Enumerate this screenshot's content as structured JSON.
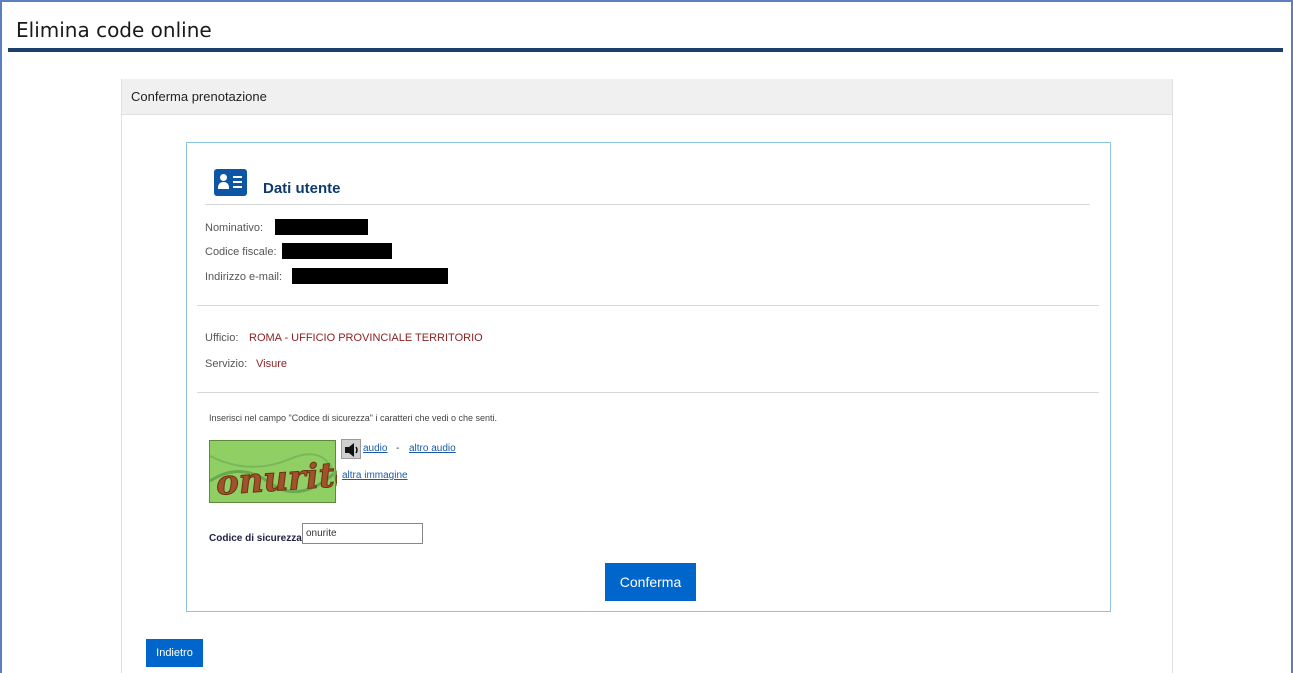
{
  "header": {
    "title": "Elimina code online"
  },
  "panel": {
    "title": "Conferma prenotazione"
  },
  "user": {
    "heading": "Dati utente",
    "icon": "user-card-icon",
    "fields": [
      {
        "label": "Nominativo:"
      },
      {
        "label": "Codice fiscale:"
      },
      {
        "label": "Indirizzo e-mail:"
      }
    ]
  },
  "booking": {
    "office_label": "Ufficio:",
    "office_value": "ROMA - UFFICIO PROVINCIALE TERRITORIO",
    "service_label": "Servizio:",
    "service_value": "Visure",
    "value_color": "#8b1f1f"
  },
  "captcha": {
    "instruction": "Inserisci nel campo \"Codice di sicurezza\" i caratteri che vedi o che senti.",
    "image_text": "onurite",
    "audio_icon": "speaker-icon",
    "audio_link": "audio",
    "separator": "-",
    "other_audio_link": "altro audio",
    "other_image_link": "altra immagine",
    "code_label": "Codice di sicurezza:",
    "code_value": "onurite"
  },
  "actions": {
    "confirm_label": "Conferma",
    "back_label": "Indietro"
  },
  "colors": {
    "accent": "#0066cc",
    "header_rule": "#1c3f6e",
    "card_border": "#8ec3dd"
  }
}
